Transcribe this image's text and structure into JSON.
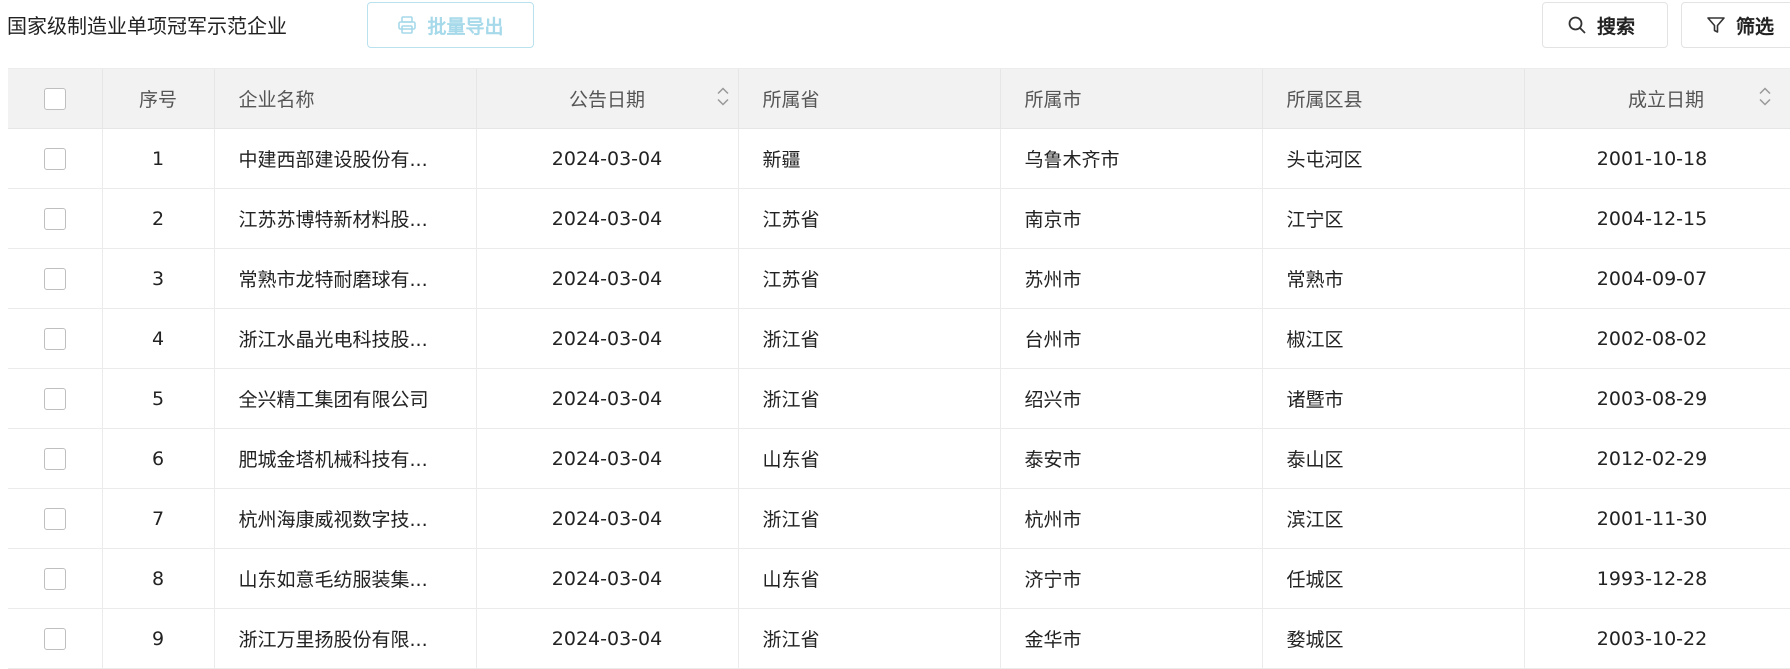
{
  "header": {
    "title": "国家级制造业单项冠军示范企业",
    "export_label": "批量导出",
    "search_label": "搜索",
    "filter_label": "筛选",
    "export_icon": "printer-icon",
    "search_icon": "search-icon",
    "filter_icon": "filter-icon",
    "export_color": "#a6d9ea"
  },
  "table": {
    "columns": {
      "index": "序号",
      "name": "企业名称",
      "announce_date": "公告日期",
      "province": "所属省",
      "city": "所属市",
      "district": "所属区县",
      "established": "成立日期"
    },
    "rows": [
      {
        "index": "1",
        "name": "中建西部建设股份有...",
        "announce_date": "2024-03-04",
        "province": "新疆",
        "city": "乌鲁木齐市",
        "district": "头屯河区",
        "established": "2001-10-18"
      },
      {
        "index": "2",
        "name": "江苏苏博特新材料股...",
        "announce_date": "2024-03-04",
        "province": "江苏省",
        "city": "南京市",
        "district": "江宁区",
        "established": "2004-12-15"
      },
      {
        "index": "3",
        "name": "常熟市龙特耐磨球有...",
        "announce_date": "2024-03-04",
        "province": "江苏省",
        "city": "苏州市",
        "district": "常熟市",
        "established": "2004-09-07"
      },
      {
        "index": "4",
        "name": "浙江水晶光电科技股...",
        "announce_date": "2024-03-04",
        "province": "浙江省",
        "city": "台州市",
        "district": "椒江区",
        "established": "2002-08-02"
      },
      {
        "index": "5",
        "name": "全兴精工集团有限公司",
        "announce_date": "2024-03-04",
        "province": "浙江省",
        "city": "绍兴市",
        "district": "诸暨市",
        "established": "2003-08-29"
      },
      {
        "index": "6",
        "name": "肥城金塔机械科技有...",
        "announce_date": "2024-03-04",
        "province": "山东省",
        "city": "泰安市",
        "district": "泰山区",
        "established": "2012-02-29"
      },
      {
        "index": "7",
        "name": "杭州海康威视数字技...",
        "announce_date": "2024-03-04",
        "province": "浙江省",
        "city": "杭州市",
        "district": "滨江区",
        "established": "2001-11-30"
      },
      {
        "index": "8",
        "name": "山东如意毛纺服装集...",
        "announce_date": "2024-03-04",
        "province": "山东省",
        "city": "济宁市",
        "district": "任城区",
        "established": "1993-12-28"
      },
      {
        "index": "9",
        "name": "浙江万里扬股份有限...",
        "announce_date": "2024-03-04",
        "province": "浙江省",
        "city": "金华市",
        "district": "婺城区",
        "established": "2003-10-22"
      }
    ]
  }
}
